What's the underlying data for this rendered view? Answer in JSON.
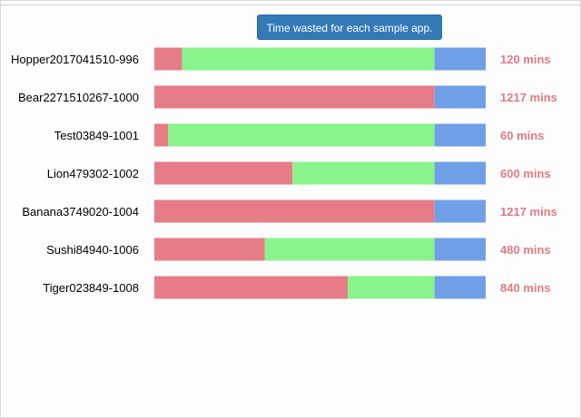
{
  "chart_data": {
    "type": "bar",
    "orientation": "horizontal",
    "stacked": true,
    "title": "Time wasted for each sample app.",
    "categories": [
      "Hopper2017041510-996",
      "Bear2271510267-1000",
      "Test03849-1001",
      "Lion479302-1002",
      "Banana3749020-1004",
      "Sushi84940-1006",
      "Tiger023849-1008"
    ],
    "totals": [
      "120 mins",
      "1217 mins",
      "60 mins",
      "600 mins",
      "1217 mins",
      "480 mins",
      "840 mins"
    ],
    "series": [
      {
        "values": [
          120,
          1217,
          60,
          600,
          1217,
          480,
          840
        ],
        "color": "#e67c88"
      },
      {
        "values": [
          1097,
          0,
          1157,
          617,
          0,
          737,
          377
        ],
        "color": "#88f48b"
      },
      {
        "values": [
          222,
          222,
          222,
          222,
          222,
          222,
          222
        ],
        "color": "#6f9fe6"
      }
    ],
    "xlim": [
      0,
      1439
    ],
    "grid": false,
    "legend": "none"
  }
}
